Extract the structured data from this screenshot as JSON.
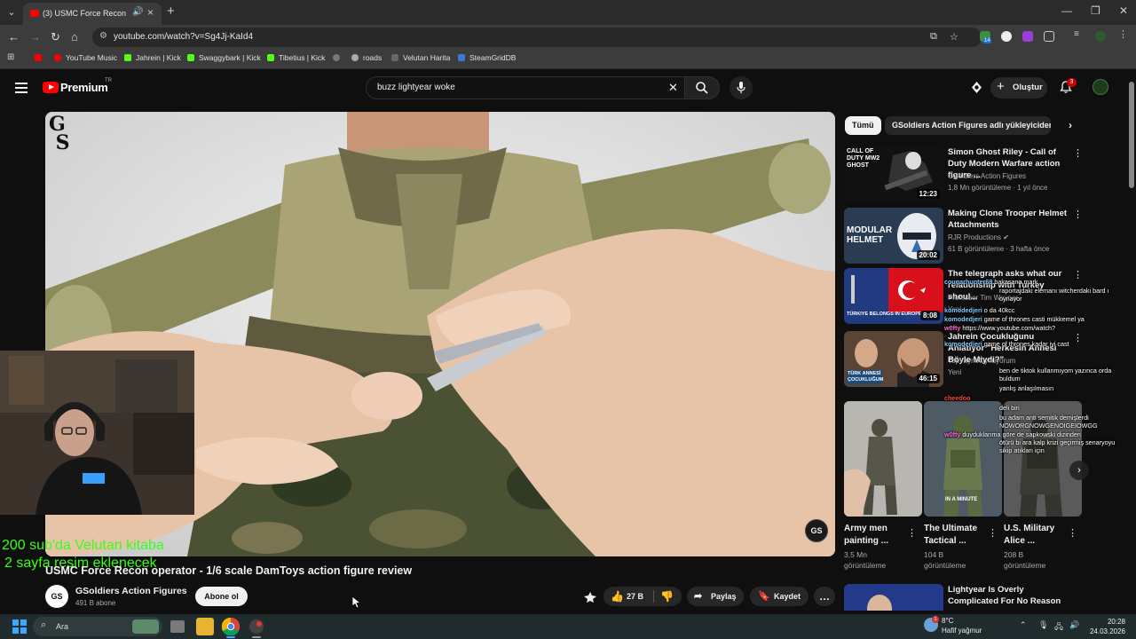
{
  "browser": {
    "tab_title": "(3) USMC Force Recon oper",
    "url": "youtube.com/watch?v=Sg4Jj-KaId4",
    "bookmarks": [
      {
        "label": "",
        "color": "#ff0000"
      },
      {
        "label": "YouTube Music",
        "color": "#ff0000"
      },
      {
        "label": "Jahrein | Kick",
        "color": "#53fc18"
      },
      {
        "label": "Swaggybark | Kick",
        "color": "#53fc18"
      },
      {
        "label": "Tibetius | Kick",
        "color": "#53fc18"
      },
      {
        "label": "",
        "color": "#777777"
      },
      {
        "label": "roads",
        "color": "#aaaaaa"
      },
      {
        "label": "Velutan Harita",
        "color": "#666666"
      },
      {
        "label": "SteamGridDB",
        "color": "#3a7bd5"
      }
    ],
    "extension_badge": "14"
  },
  "youtube": {
    "brand": "Premium",
    "region": "TR",
    "search_query": "buzz lightyear woke",
    "create_label": "Oluştur",
    "notifications": "3"
  },
  "video": {
    "title": "USMC Force Recon operator - 1/6 scale DamToys action figure review",
    "channel_mark": "GS",
    "channel": "GSoldiers Action Figures",
    "subscribers": "491 B abone",
    "subscribe_label": "Abone ol",
    "likes": "27 B",
    "share_label": "Paylaş",
    "save_label": "Kaydet"
  },
  "overlay": {
    "line1": "200 sub'da Velutan kitaba",
    "line2": "2 sayfa resim eklenecek"
  },
  "sidebar": {
    "chips": [
      "Tümü",
      "GSoldiers Action Figures adlı yükleyiciden"
    ],
    "recommendations": [
      {
        "title": "Simon Ghost Riley - Call of Duty Modern Warfare action figure ...",
        "channel": "GSoldiers Action Figures",
        "meta": "1,8 Mn görüntüleme · 1 yıl önce",
        "duration": "12:23",
        "thumb_text": "CALL OF DUTY MW2 GHOST"
      },
      {
        "title": "Making Clone Trooper Helmet Attachments",
        "channel": "RJR Productions ✔",
        "meta": "61 B görüntüleme · 3 hafta önce",
        "duration": "20:02",
        "thumb_text": "MODULAR HELMET"
      },
      {
        "title": "The telegraph asks what our relationship with Turkey shoul...",
        "channel": "Professor Tim Woynar",
        "meta": "Yeni",
        "duration": "8:08",
        "thumb_text": "TÜRKIYE BELONGS IN EUROPE"
      },
      {
        "title": "Jahrein Çocukluğunu Anlatıyor \"Herkesin Annesi Böyle Miydi?\"",
        "channel": "TopVayneOynuyorum",
        "meta": "Yeni",
        "duration": "46:15",
        "thumb_text": "TÜRK ANNESİ ÇOCUKLUĞUM"
      }
    ],
    "shorts": [
      {
        "title": "Army men painting ...",
        "views": "3,5 Mn görüntüleme",
        "label": ""
      },
      {
        "title": "The Ultimate Tactical ...",
        "views": "104 B görüntüleme",
        "label": "IN A MINUTE"
      },
      {
        "title": "U.S. Military Alice ...",
        "views": "208 B görüntüleme",
        "label": ""
      }
    ],
    "next_rec": {
      "title": "Lightyear Is Overly Complicated For No Reason"
    }
  },
  "chat": [
    {
      "user": "cougarhunter69",
      "text": "bakasana mark",
      "color": "#7ecbff"
    },
    {
      "user": "",
      "text": "raportajdaki elemanı witcherdaki bard ı",
      "color": "#ffffff"
    },
    {
      "user": "",
      "text": "oynayor",
      "color": "#ffffff"
    },
    {
      "user": "komodedjeri",
      "text": "o da 40kcc",
      "color": "#7ecbff"
    },
    {
      "user": "komodedjeri",
      "text": "game of thrones casti mükkemel ya",
      "color": "#7ecbff"
    },
    {
      "user": "w0fty",
      "text": "https://www.youtube.com/watch?",
      "color": "#ff6bd6"
    },
    {
      "user": "komodedjeri",
      "text": "game of thrones kadar iyi cast",
      "color": "#7ecbff"
    },
    {
      "user": "",
      "text": "ben de tiktok kullanmıyom yazınca orda",
      "color": "#ffffff"
    },
    {
      "user": "",
      "text": "buldum",
      "color": "#ffffff"
    },
    {
      "user": "",
      "text": "yanlış anlaşılmasın",
      "color": "#ffffff"
    },
    {
      "user": "cheedoo",
      "text": "",
      "color": "#ff4444"
    },
    {
      "user": "",
      "text": "deli biri",
      "color": "#ffffff"
    },
    {
      "user": "",
      "text": "bu adam anti semitik demişlerdi",
      "color": "#ffffff"
    },
    {
      "user": "",
      "text": "NOWORGNOWGENOIGEIOWGG",
      "color": "#ffffff"
    },
    {
      "user": "w0fty",
      "text": "duyduklarıma göre de sapkowski dizinden",
      "color": "#ff6bd6"
    },
    {
      "user": "",
      "text": "ötürü bi ara kalp krizi geçirmiş senaryoyu",
      "color": "#ffffff"
    },
    {
      "user": "",
      "text": "sikip atıkları için",
      "color": "#ffffff"
    }
  ],
  "taskbar": {
    "search": "Ara",
    "weather_temp": "8°C",
    "weather_desc": "Hafif yağmur",
    "time": "20:28",
    "date": "24.03.2026"
  }
}
